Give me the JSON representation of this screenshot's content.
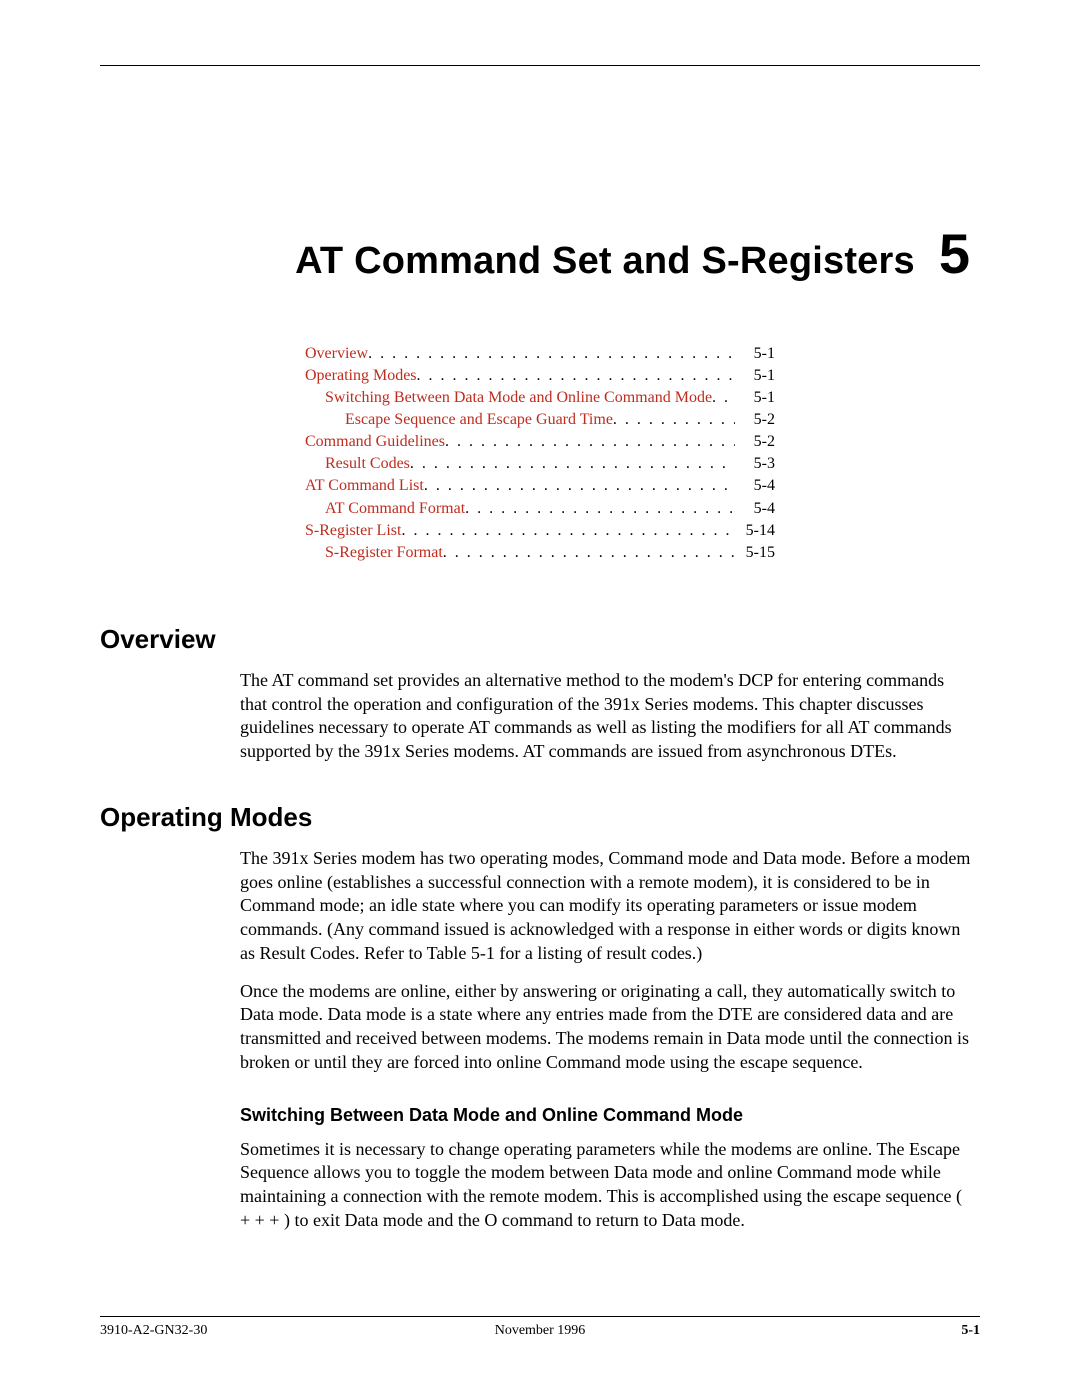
{
  "chapter": {
    "title": "AT Command Set and S-Registers",
    "number": "5"
  },
  "toc": [
    {
      "level": 1,
      "label": "Overview",
      "page": "5-1"
    },
    {
      "level": 1,
      "label": "Operating Modes",
      "page": "5-1"
    },
    {
      "level": 2,
      "label": "Switching Between Data Mode and Online Command Mode",
      "page": "5-1"
    },
    {
      "level": 3,
      "label": "Escape Sequence and Escape Guard Time",
      "page": "5-2"
    },
    {
      "level": 1,
      "label": "Command Guidelines",
      "page": "5-2"
    },
    {
      "level": 2,
      "label": "Result Codes",
      "page": "5-3"
    },
    {
      "level": 1,
      "label": "AT Command List",
      "page": "5-4"
    },
    {
      "level": 2,
      "label": "AT Command Format",
      "page": "5-4"
    },
    {
      "level": 1,
      "label": "S-Register List",
      "page": "5-14"
    },
    {
      "level": 2,
      "label": "S-Register Format",
      "page": "5-15"
    }
  ],
  "sections": {
    "overview": {
      "heading": "Overview",
      "para1": "The AT command set provides an alternative method to the modem's DCP for entering commands that control the operation and configuration of the 391x Series modems. This chapter discusses guidelines necessary to operate AT commands as well as listing the modifiers for all AT commands supported by the 391x Series modems. AT commands are issued from asynchronous DTEs."
    },
    "operating_modes": {
      "heading": "Operating Modes",
      "para1": "The 391x Series modem has two operating modes, Command mode and Data mode. Before a modem goes online (establishes a successful connection with a remote modem), it is considered to be in Command mode; an idle state where you can modify its operating parameters or issue modem commands. (Any command issued is acknowledged with a response in either words or digits known as Result Codes. Refer to Table 5-1 for a listing of result codes.)",
      "para2": "Once the modems are online, either by answering or originating a call, they automatically switch to Data mode. Data mode is a state where any entries made from the DTE are considered data and are transmitted and received between modems. The modems remain in Data mode until the connection is broken or until they are forced into online Command mode using the escape sequence."
    },
    "switching": {
      "heading": "Switching Between Data Mode and Online Command Mode",
      "para1": "Sometimes it is necessary to change operating parameters while the modems are online. The Escape Sequence allows you to toggle the modem between Data mode and online Command mode while maintaining a connection with the remote modem. This is accomplished using the escape sequence ( + + + ) to exit Data mode and the O command to return to Data mode."
    }
  },
  "footer": {
    "left": "3910-A2-GN32-30",
    "center": "November 1996",
    "right": "5-1"
  }
}
